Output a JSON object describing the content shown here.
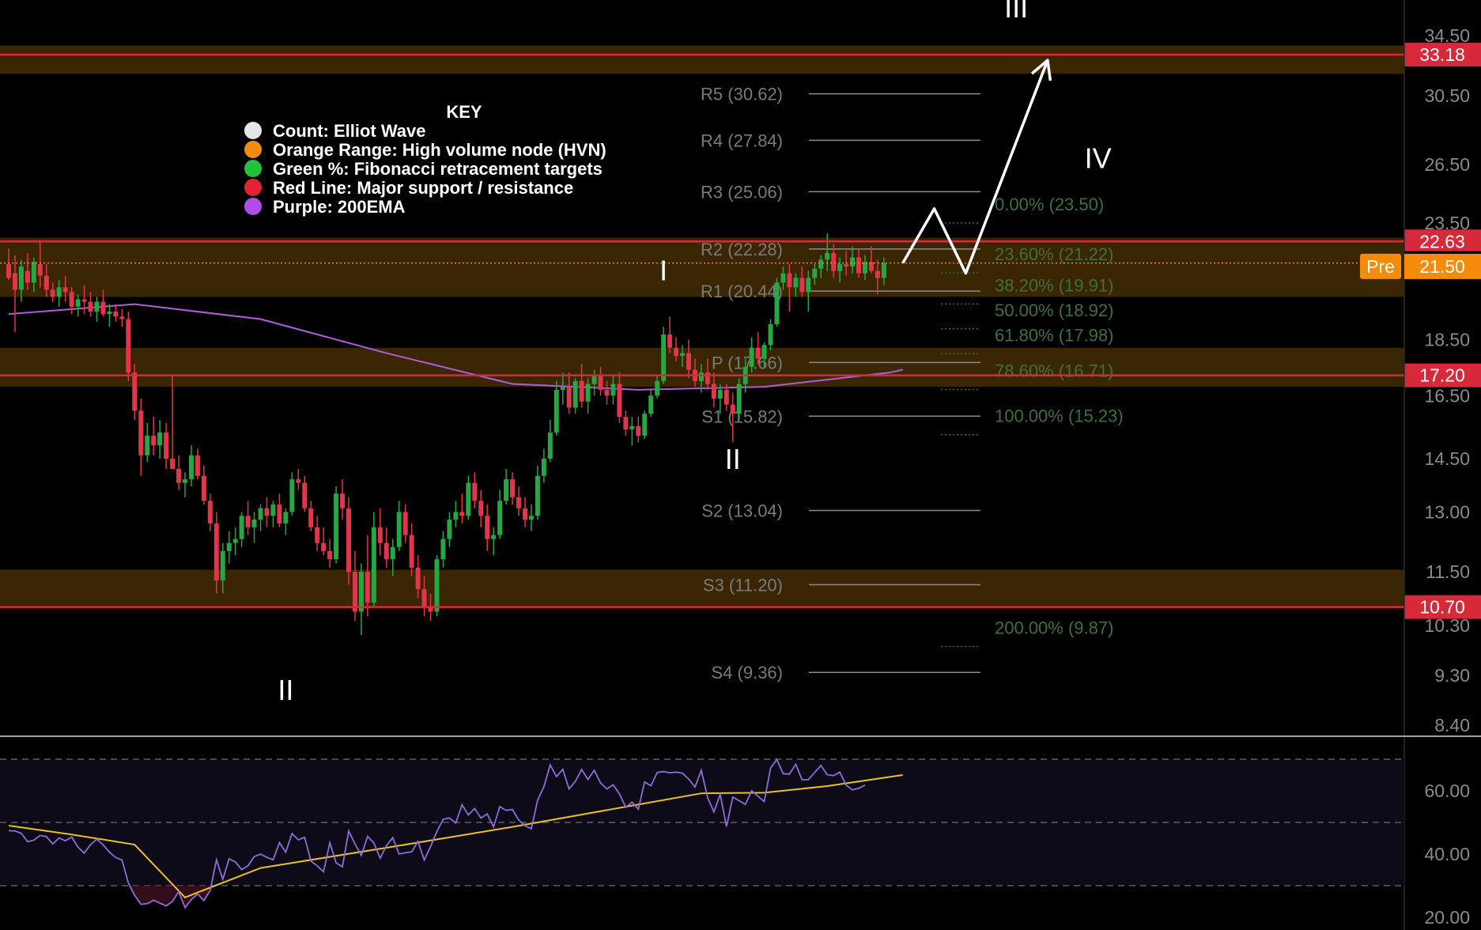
{
  "colors": {
    "background": "#000000",
    "hvn_zone": "#3b2604",
    "resistance_line": "#d8293a",
    "ema200": "#b05ed8",
    "bull_candle": "#27a644",
    "bear_candle": "#e0354c",
    "rsi": "#8e6cd8",
    "rsi_ma": "#e8c027",
    "pre_badge": "#f48b0a",
    "wave_label": "#ffffff",
    "fib_text": "#3f6e3f",
    "pivot_text": "#7a7a7a"
  },
  "key": {
    "title": "KEY",
    "items": [
      {
        "label": "Count: Elliot Wave",
        "color": "#e6e6e6"
      },
      {
        "label": "Orange Range: High volume node (HVN)",
        "color": "#f28c0f"
      },
      {
        "label": "Green %: Fibonacci retracement targets",
        "color": "#22c33a"
      },
      {
        "label": "Red Line: Major support / resistance",
        "color": "#e3232f"
      },
      {
        "label": "Purple: 200EMA",
        "color": "#b04ce8"
      }
    ]
  },
  "chart_data": [
    {
      "type": "candlestick",
      "scale": "log",
      "ylim": [
        8.4,
        34.5
      ],
      "price_ticks": [
        "34.50",
        "30.50",
        "26.50",
        "23.50",
        "18.50",
        "16.50",
        "14.50",
        "13.00",
        "11.50",
        "10.30",
        "9.30",
        "8.40"
      ],
      "ohlc": [
        [
          21.6,
          22.3,
          20.9,
          21.0
        ],
        [
          21.2,
          22.0,
          18.8,
          20.5
        ],
        [
          20.5,
          21.8,
          20.0,
          21.5
        ],
        [
          21.3,
          22.1,
          20.5,
          20.8
        ],
        [
          20.8,
          21.9,
          20.4,
          21.7
        ],
        [
          21.6,
          22.7,
          20.6,
          21.1
        ],
        [
          21.1,
          21.6,
          20.2,
          20.5
        ],
        [
          20.5,
          20.8,
          20.0,
          20.2
        ],
        [
          20.2,
          20.9,
          19.8,
          20.6
        ],
        [
          20.6,
          21.1,
          20.0,
          20.4
        ],
        [
          20.4,
          20.6,
          19.5,
          19.8
        ],
        [
          19.8,
          20.3,
          19.4,
          20.1
        ],
        [
          20.1,
          20.7,
          19.5,
          20.0
        ],
        [
          20.0,
          20.4,
          19.4,
          19.6
        ],
        [
          19.6,
          20.2,
          19.2,
          20.0
        ],
        [
          20.0,
          20.5,
          19.4,
          19.5
        ],
        [
          19.5,
          19.9,
          19.0,
          19.6
        ],
        [
          19.6,
          19.9,
          19.2,
          19.4
        ],
        [
          19.4,
          19.7,
          19.0,
          19.3
        ],
        [
          19.3,
          19.6,
          17.0,
          17.3
        ],
        [
          17.3,
          17.6,
          15.7,
          16.0
        ],
        [
          16.0,
          16.4,
          14.0,
          14.6
        ],
        [
          14.6,
          15.6,
          14.4,
          15.2
        ],
        [
          15.2,
          15.8,
          14.6,
          14.9
        ],
        [
          14.9,
          15.7,
          14.5,
          15.3
        ],
        [
          15.3,
          15.6,
          14.2,
          14.5
        ],
        [
          14.5,
          17.2,
          14.4,
          14.2
        ],
        [
          14.2,
          14.6,
          13.6,
          13.8
        ],
        [
          13.8,
          14.1,
          13.4,
          13.9
        ],
        [
          13.9,
          14.9,
          13.7,
          14.6
        ],
        [
          14.6,
          14.8,
          13.9,
          14.0
        ],
        [
          14.0,
          14.3,
          13.2,
          13.3
        ],
        [
          13.3,
          13.5,
          12.5,
          12.7
        ],
        [
          12.7,
          13.0,
          11.0,
          11.3
        ],
        [
          11.3,
          12.2,
          11.0,
          12.0
        ],
        [
          12.0,
          12.5,
          11.7,
          12.2
        ],
        [
          12.2,
          12.6,
          11.9,
          12.3
        ],
        [
          12.3,
          13.0,
          12.1,
          12.9
        ],
        [
          12.9,
          13.3,
          12.4,
          12.6
        ],
        [
          12.6,
          13.0,
          12.2,
          12.8
        ],
        [
          12.8,
          13.2,
          12.5,
          13.1
        ],
        [
          13.1,
          13.4,
          12.6,
          12.9
        ],
        [
          12.9,
          13.3,
          12.6,
          13.2
        ],
        [
          13.2,
          13.5,
          12.6,
          12.7
        ],
        [
          12.7,
          13.1,
          12.4,
          13.0
        ],
        [
          13.0,
          14.1,
          12.9,
          13.9
        ],
        [
          13.9,
          14.2,
          13.6,
          13.8
        ],
        [
          13.8,
          14.0,
          13.0,
          13.1
        ],
        [
          13.1,
          13.3,
          12.5,
          12.6
        ],
        [
          12.6,
          12.9,
          12.0,
          12.2
        ],
        [
          12.2,
          12.6,
          11.9,
          12.0
        ],
        [
          12.0,
          12.3,
          11.6,
          11.8
        ],
        [
          11.8,
          13.7,
          11.7,
          13.5
        ],
        [
          13.5,
          13.9,
          12.8,
          13.1
        ],
        [
          13.1,
          13.4,
          11.2,
          11.5
        ],
        [
          11.5,
          12.0,
          10.4,
          10.6
        ],
        [
          10.6,
          11.7,
          10.1,
          11.5
        ],
        [
          11.5,
          12.4,
          10.5,
          10.8
        ],
        [
          10.8,
          13.0,
          10.7,
          12.6
        ],
        [
          12.6,
          13.1,
          11.9,
          12.2
        ],
        [
          12.2,
          12.6,
          11.6,
          11.8
        ],
        [
          11.8,
          12.3,
          11.4,
          12.1
        ],
        [
          12.1,
          13.3,
          12.0,
          13.0
        ],
        [
          13.0,
          13.2,
          12.2,
          12.4
        ],
        [
          12.4,
          12.7,
          11.4,
          11.6
        ],
        [
          11.6,
          11.9,
          10.9,
          11.1
        ],
        [
          11.1,
          11.4,
          10.5,
          10.7
        ],
        [
          10.7,
          11.0,
          10.4,
          10.6
        ],
        [
          10.6,
          11.9,
          10.5,
          11.8
        ],
        [
          11.8,
          12.5,
          11.6,
          12.3
        ],
        [
          12.3,
          13.0,
          12.1,
          12.8
        ],
        [
          12.8,
          13.3,
          12.6,
          13.0
        ],
        [
          13.0,
          13.5,
          12.7,
          12.9
        ],
        [
          12.9,
          14.0,
          12.8,
          13.8
        ],
        [
          13.8,
          14.1,
          13.1,
          13.3
        ],
        [
          13.3,
          13.6,
          12.6,
          12.9
        ],
        [
          12.9,
          13.2,
          12.0,
          12.3
        ],
        [
          12.3,
          12.6,
          11.9,
          12.4
        ],
        [
          12.4,
          13.6,
          12.3,
          13.3
        ],
        [
          13.3,
          14.2,
          13.2,
          13.9
        ],
        [
          13.9,
          14.1,
          13.2,
          13.4
        ],
        [
          13.4,
          13.7,
          12.9,
          13.1
        ],
        [
          13.1,
          13.4,
          12.6,
          12.8
        ],
        [
          12.8,
          13.2,
          12.5,
          12.9
        ],
        [
          12.9,
          14.3,
          12.8,
          14.0
        ],
        [
          14.0,
          14.8,
          13.8,
          14.5
        ],
        [
          14.5,
          15.7,
          14.4,
          15.3
        ],
        [
          15.3,
          17.0,
          15.2,
          16.7
        ],
        [
          16.7,
          17.3,
          16.2,
          16.8
        ],
        [
          16.8,
          17.3,
          15.9,
          16.1
        ],
        [
          16.1,
          17.1,
          15.9,
          17.0
        ],
        [
          17.0,
          17.6,
          16.1,
          16.3
        ],
        [
          16.3,
          17.1,
          15.9,
          16.9
        ],
        [
          16.9,
          17.4,
          16.5,
          17.2
        ],
        [
          17.2,
          17.5,
          16.5,
          16.7
        ],
        [
          16.7,
          17.0,
          16.2,
          16.5
        ],
        [
          16.5,
          17.2,
          16.2,
          16.9
        ],
        [
          16.9,
          17.3,
          15.6,
          15.8
        ],
        [
          15.8,
          16.0,
          15.2,
          15.4
        ],
        [
          15.4,
          15.8,
          14.9,
          15.5
        ],
        [
          15.5,
          15.8,
          15.0,
          15.2
        ],
        [
          15.2,
          16.0,
          15.1,
          15.9
        ],
        [
          15.9,
          16.7,
          15.8,
          16.5
        ],
        [
          16.5,
          17.2,
          16.4,
          17.0
        ],
        [
          17.0,
          19.0,
          16.9,
          18.7
        ],
        [
          18.7,
          19.4,
          18.0,
          18.2
        ],
        [
          18.2,
          18.6,
          17.7,
          17.9
        ],
        [
          17.9,
          18.3,
          17.5,
          18.0
        ],
        [
          18.0,
          18.5,
          17.1,
          17.4
        ],
        [
          17.4,
          17.8,
          16.8,
          17.0
        ],
        [
          17.0,
          17.6,
          16.6,
          17.3
        ],
        [
          17.3,
          17.8,
          16.7,
          16.9
        ],
        [
          16.9,
          17.3,
          16.1,
          16.4
        ],
        [
          16.4,
          16.9,
          15.9,
          16.7
        ],
        [
          16.7,
          16.9,
          16.0,
          16.2
        ],
        [
          16.2,
          16.6,
          15.0,
          15.9
        ],
        [
          15.9,
          17.1,
          15.7,
          16.9
        ],
        [
          16.9,
          17.8,
          16.6,
          17.5
        ],
        [
          17.5,
          18.6,
          17.3,
          18.2
        ],
        [
          18.2,
          18.8,
          17.6,
          17.8
        ],
        [
          17.8,
          18.4,
          17.5,
          18.3
        ],
        [
          18.3,
          19.3,
          18.1,
          19.1
        ],
        [
          19.1,
          21.0,
          19.0,
          20.8
        ],
        [
          20.8,
          21.5,
          20.5,
          21.2
        ],
        [
          21.2,
          21.6,
          19.6,
          20.6
        ],
        [
          20.6,
          21.2,
          20.2,
          21.0
        ],
        [
          21.0,
          21.5,
          20.2,
          20.4
        ],
        [
          20.4,
          21.3,
          19.6,
          21.0
        ],
        [
          21.0,
          21.6,
          20.7,
          21.4
        ],
        [
          21.4,
          22.0,
          21.0,
          21.8
        ],
        [
          21.8,
          23.0,
          21.3,
          22.1
        ],
        [
          22.1,
          22.5,
          21.0,
          21.3
        ],
        [
          21.3,
          21.9,
          20.8,
          21.6
        ],
        [
          21.6,
          22.2,
          21.1,
          21.5
        ],
        [
          21.5,
          22.4,
          21.2,
          21.9
        ],
        [
          21.9,
          22.3,
          21.0,
          21.2
        ],
        [
          21.2,
          22.0,
          20.9,
          21.7
        ],
        [
          21.7,
          22.4,
          21.2,
          21.3
        ],
        [
          21.3,
          21.8,
          20.3,
          21.0
        ],
        [
          21.0,
          21.9,
          20.7,
          21.65
        ]
      ],
      "ema200": [
        [
          0,
          19.5
        ],
        [
          20,
          19.9
        ],
        [
          40,
          19.3
        ],
        [
          60,
          18.0
        ],
        [
          80,
          16.9
        ],
        [
          100,
          16.7
        ],
        [
          120,
          16.8
        ],
        [
          140,
          17.3
        ],
        [
          142,
          17.4
        ]
      ]
    },
    {
      "type": "horizontal_levels",
      "hvn_zones": [
        [
          31.9,
          33.8
        ],
        [
          20.2,
          22.8
        ],
        [
          16.8,
          18.2
        ],
        [
          10.7,
          11.55
        ]
      ],
      "resistance_lines": [
        {
          "value": 33.18,
          "label": "33.18"
        },
        {
          "value": 22.63,
          "label": "22.63"
        },
        {
          "value": 17.2,
          "label": "17.20"
        },
        {
          "value": 10.7,
          "label": "10.70"
        }
      ],
      "last_price": {
        "value": 21.65,
        "label": "21.65"
      },
      "premarket": {
        "tag": "Pre",
        "value": 21.5,
        "label": "21.50"
      }
    },
    {
      "type": "pivot_levels",
      "levels": [
        {
          "label": "R5 (30.62)",
          "value": 30.62
        },
        {
          "label": "R4 (27.84)",
          "value": 27.84
        },
        {
          "label": "R3 (25.06)",
          "value": 25.06
        },
        {
          "label": "R2 (22.28)",
          "value": 22.28
        },
        {
          "label": "R1 (20.44)",
          "value": 20.44
        },
        {
          "label": "P (17.66)",
          "value": 17.66
        },
        {
          "label": "S1 (15.82)",
          "value": 15.82
        },
        {
          "label": "S2 (13.04)",
          "value": 13.04
        },
        {
          "label": "S3 (11.20)",
          "value": 11.2
        },
        {
          "label": "S4 (9.36)",
          "value": 9.36
        }
      ]
    },
    {
      "type": "fibonacci",
      "levels": [
        {
          "label": "0.00% (23.50)",
          "value": 23.5
        },
        {
          "label": "23.60% (21.22)",
          "value": 21.22
        },
        {
          "label": "38.20% (19.91)",
          "value": 19.91
        },
        {
          "label": "50.00% (18.92)",
          "value": 18.92
        },
        {
          "label": "61.80% (17.98)",
          "value": 17.98
        },
        {
          "label": "78.60% (16.71)",
          "value": 16.71
        },
        {
          "label": "100.00% (15.23)",
          "value": 15.23
        },
        {
          "label": "200.00% (9.87)",
          "value": 9.87
        }
      ]
    },
    {
      "type": "elliott_wave",
      "labels": [
        {
          "text": "II",
          "bar": 44,
          "price": 8.85
        },
        {
          "text": "I",
          "bar": 104,
          "price": 20.9
        },
        {
          "text": "II",
          "bar": 115,
          "price": 14.2
        },
        {
          "text": "III",
          "bar": 160,
          "price": 35.8
        },
        {
          "text": "IV",
          "bar": 173,
          "price": 26.3
        }
      ],
      "projection": [
        [
          142,
          21.65
        ],
        [
          147,
          24.2
        ],
        [
          152,
          21.2
        ],
        [
          165,
          32.8
        ]
      ]
    },
    {
      "type": "line",
      "name": "RSI",
      "ylim": [
        20,
        70
      ],
      "y_ticks": [
        "60.00",
        "40.00",
        "20.00"
      ],
      "bands": [
        70,
        50,
        30
      ],
      "rsi": [
        47.4,
        47.3,
        46.6,
        43.9,
        44.4,
        45.9,
        45.5,
        43.2,
        45.1,
        44.2,
        45.4,
        42.2,
        40.3,
        43.0,
        44.7,
        42.9,
        40.6,
        38.9,
        38.1,
        30.9,
        27.0,
        24.1,
        24.3,
        25.4,
        24.5,
        23.6,
        25.0,
        28.1,
        23.1,
        25.6,
        27.4,
        25.3,
        28.5,
        38.2,
        32.0,
        38.5,
        37.5,
        35.1,
        36.3,
        39.2,
        40.0,
        39.0,
        38.2,
        43.6,
        40.6,
        46.5,
        44.5,
        45.3,
        37.8,
        36.3,
        34.4,
        43.6,
        37.2,
        36.0,
        47.3,
        43.2,
        39.6,
        45.6,
        43.5,
        38.7,
        42.7,
        45.2,
        40.0,
        40.4,
        40.7,
        44.0,
        38.1,
        42.4,
        47.1,
        51.0,
        51.4,
        49.8,
        55.6,
        52.4,
        54.4,
        51.4,
        52.7,
        48.6,
        55.0,
        53.8,
        54.1,
        50.8,
        49.0,
        48.0,
        57.0,
        61.3,
        68.2,
        64.5,
        66.8,
        60.6,
        63.0,
        66.7,
        63.6,
        66.5,
        62.5,
        60.6,
        61.9,
        59.0,
        54.8,
        56.4,
        54.2,
        62.8,
        61.6,
        65.8,
        66.1,
        65.7,
        65.9,
        65.6,
        63.7,
        61.2,
        66.5,
        57.9,
        53.3,
        58.9,
        48.7,
        58.0,
        56.9,
        55.7,
        60.0,
        58.3,
        56.6,
        67.2,
        69.9,
        65.4,
        65.3,
        68.4,
        63.5,
        63.5,
        65.8,
        68.0,
        65.1,
        64.8,
        65.9,
        61.8,
        60.3,
        60.8,
        61.8
      ],
      "rsi_ma": [
        [
          0,
          49.0
        ],
        [
          10,
          46.2
        ],
        [
          20,
          43.0
        ],
        [
          28,
          26.3
        ],
        [
          40,
          35.6
        ],
        [
          60,
          42.0
        ],
        [
          80,
          48.6
        ],
        [
          110,
          59.2
        ],
        [
          120,
          59.4
        ],
        [
          130,
          61.5
        ],
        [
          142,
          65.0
        ]
      ]
    }
  ]
}
